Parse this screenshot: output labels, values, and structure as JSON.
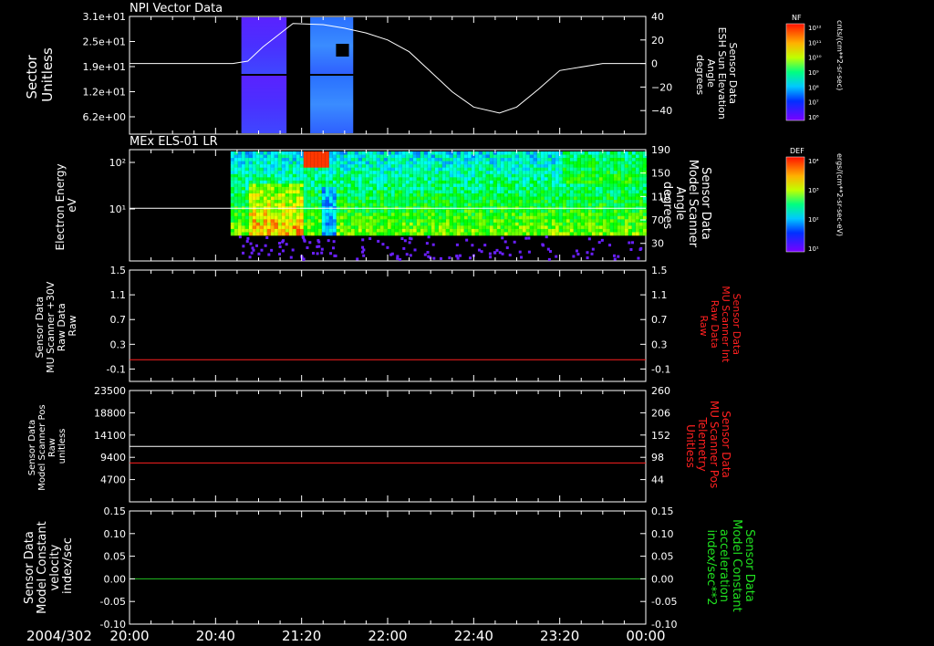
{
  "chart_data": [
    {
      "type": "heatmap",
      "title": "NPI Vector Data",
      "ylabel": [
        "Sector",
        "Unitless"
      ],
      "ytick_labels": [
        "3.1e+01",
        "2.5e+01",
        "1.9e+01",
        "1.2e+01",
        "6.2e+00"
      ],
      "y2label": [
        "Sensor Data",
        "ESH Sun Elevation",
        "Angle",
        "degrees"
      ],
      "y2_ticks": [
        40,
        20,
        0,
        -20,
        -40
      ],
      "y2lim": [
        -60,
        40
      ],
      "line_series": {
        "color": "#ffffff",
        "x": [
          0,
          40,
          48,
          55,
          62,
          76,
          90,
          100,
          110,
          120,
          130,
          140,
          150,
          160,
          172,
          180,
          190,
          200,
          220,
          240
        ],
        "y": [
          0,
          0,
          0,
          2,
          14,
          34,
          33,
          30,
          26,
          20,
          10,
          -7,
          -24,
          -37,
          -42,
          -37,
          -22,
          -6,
          0,
          0
        ]
      },
      "heatmap_blocks_minutes": [
        [
          52,
          73
        ],
        [
          84,
          104
        ]
      ],
      "colorbar": {
        "label": "NF",
        "unit": "cnts/(cm**2-sr-sec)",
        "ticks": [
          "10¹²",
          "10¹¹",
          "10¹⁰",
          "10⁹",
          "10⁸",
          "10⁷",
          "10⁶"
        ]
      }
    },
    {
      "type": "heatmap",
      "title": "MEx ELS-01 LR",
      "ylabel": [
        "Electron Energy",
        "eV"
      ],
      "ytick_labels": [
        "10²",
        "10¹"
      ],
      "y2label": [
        "Sensor Data",
        "Model Scanner",
        "Angle",
        "degrees"
      ],
      "y2_ticks": [
        190,
        150,
        110,
        70,
        30
      ],
      "y2lim": [
        0,
        190
      ],
      "line_series": {
        "color": "#ffffff",
        "x": [
          0,
          240
        ],
        "y": [
          90,
          90
        ]
      },
      "data_start_minutes": 47,
      "colorbar": {
        "label": "DEF",
        "unit": "ergs/(cm**2-sr-sec-eV)",
        "ticks": [
          "10⁴",
          "10³",
          "10²",
          "10¹"
        ]
      }
    },
    {
      "type": "line",
      "ylabel": [
        "Sensor Data",
        "MU Scanner +30V",
        "Raw Data",
        "Raw"
      ],
      "y_ticks": [
        "1.5",
        "1.1",
        "0.7",
        "0.3",
        "-0.1"
      ],
      "ylim": [
        -0.3,
        1.5
      ],
      "y2label": [
        "Sensor Data",
        "MU Scanner Int",
        "Raw Data",
        "Raw"
      ],
      "y2label_color": "#ff2020",
      "series": [
        {
          "color": "#ff2020",
          "x": [
            0,
            240
          ],
          "y": [
            0.05,
            0.05
          ]
        }
      ]
    },
    {
      "type": "line",
      "ylabel": [
        "Sensor Data",
        "Model Scanner Pos",
        "Raw",
        "unitless"
      ],
      "y_ticks": [
        "23500",
        "18800",
        "14100",
        "9400",
        "4700"
      ],
      "ylim": [
        0,
        23500
      ],
      "y2label": [
        "Sensor Data",
        "MU Scanner Pos",
        "Telemetry",
        "Unitless"
      ],
      "y2label_color": "#ff2020",
      "y2_ticks": [
        "260",
        "206",
        "152",
        "98",
        "44"
      ],
      "series": [
        {
          "color": "#ffffff",
          "x": [
            0,
            240
          ],
          "y": [
            11700,
            11700
          ]
        },
        {
          "color": "#ff2020",
          "x": [
            0,
            240
          ],
          "y": [
            8200,
            8200
          ]
        }
      ]
    },
    {
      "type": "line",
      "ylabel": [
        "Sensor Data",
        "Model Constant",
        "velocity",
        "index/sec"
      ],
      "y_ticks": [
        "0.15",
        "0.10",
        "0.05",
        "0.00",
        "-0.05",
        "-0.10"
      ],
      "ylim": [
        -0.1,
        0.15
      ],
      "y2label": [
        "Sensor Data",
        "Model Constant",
        "acceleration",
        "index/sec**2"
      ],
      "y2label_color": "#20e020",
      "y2_ticks": [
        "0.15",
        "0.10",
        "0.05",
        "0.00",
        "-0.05",
        "-0.10"
      ],
      "series": [
        {
          "color": "#20c020",
          "x": [
            0,
            240
          ],
          "y": [
            0.0,
            0.0
          ]
        }
      ]
    }
  ],
  "x_axis": {
    "date_label": "2004/302",
    "tick_labels": [
      "20:00",
      "20:40",
      "21:20",
      "22:00",
      "22:40",
      "23:20",
      "00:00"
    ],
    "range_minutes": [
      0,
      240
    ]
  }
}
